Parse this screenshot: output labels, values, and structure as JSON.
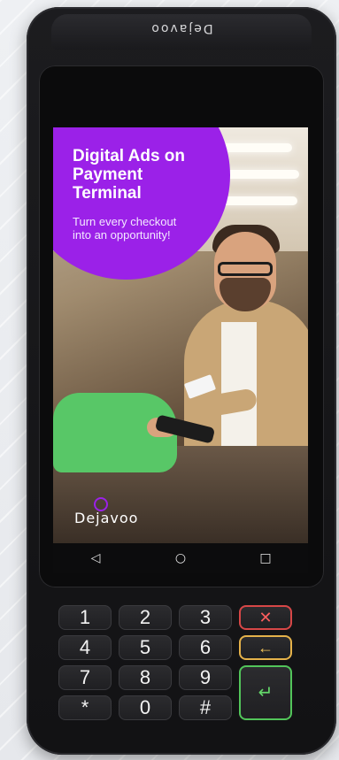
{
  "device": {
    "brand_top": "Dejavoo"
  },
  "ad": {
    "title": "Digital Ads on Payment Terminal",
    "subtitle": "Turn every checkout into an opportunity!",
    "logo": "Dejavoo",
    "bubble_color": "#9b21e8"
  },
  "navigation": {
    "back": "◁",
    "home": "○",
    "recent": "□"
  },
  "keypad": {
    "k1": "1",
    "k2": "2",
    "k3": "3",
    "cancel": "✕",
    "k4": "4",
    "k5": "5",
    "k6": "6",
    "clear": "←",
    "k7": "7",
    "k8": "8",
    "k9": "9",
    "enter": "↵",
    "star": "*",
    "k0": "0",
    "hash": "#"
  },
  "colors": {
    "cancel": "#d74747",
    "clear": "#e5b24a",
    "enter": "#52c55a"
  }
}
